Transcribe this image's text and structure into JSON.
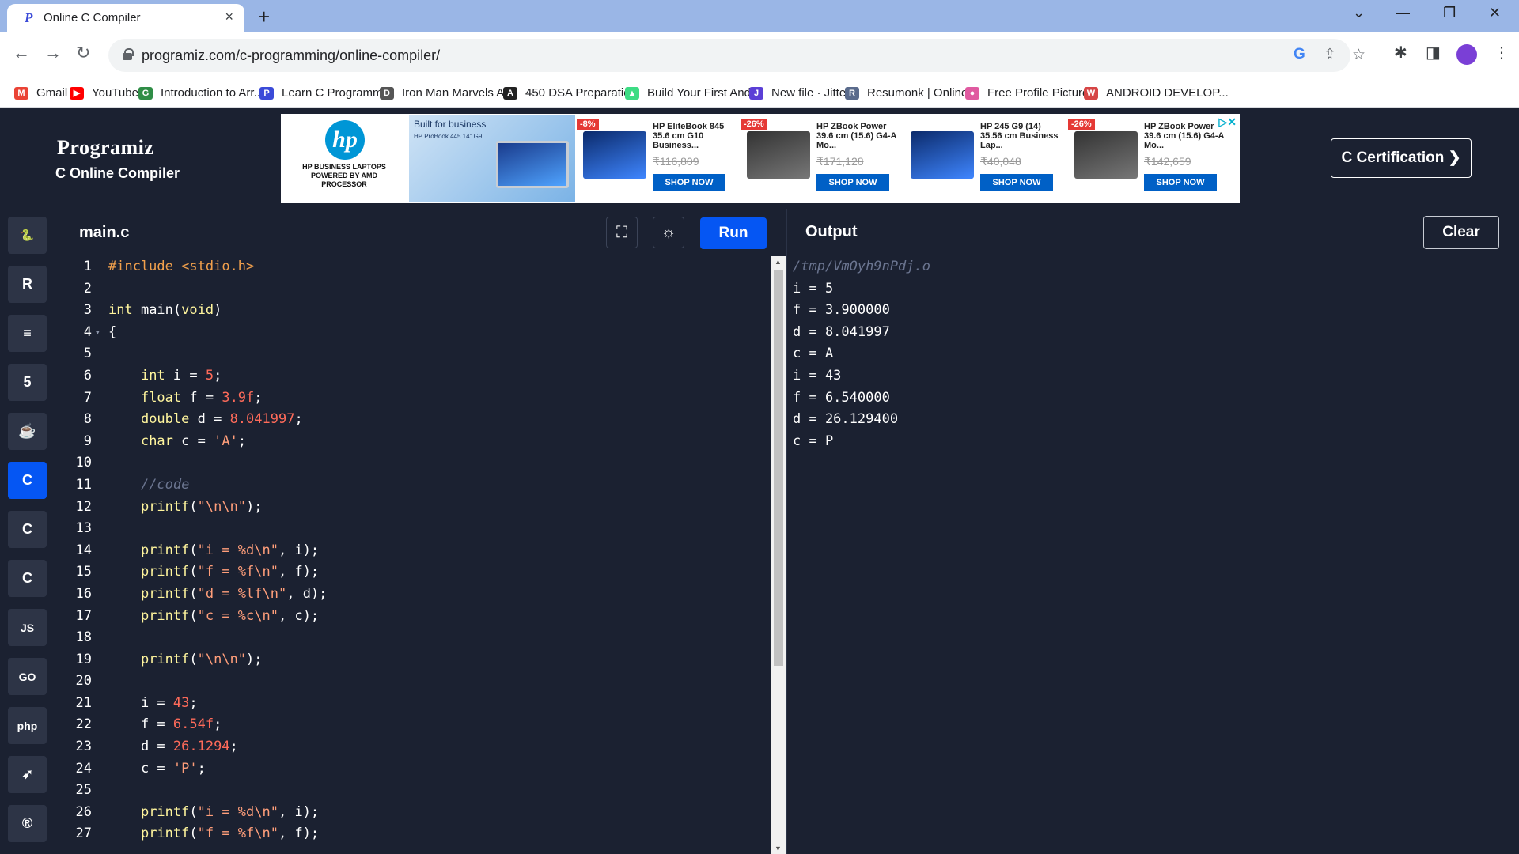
{
  "browser": {
    "tab_title": "Online C Compiler",
    "tab_close": "×",
    "new_tab": "+",
    "url": "programiz.com/c-programming/online-compiler/",
    "bookmarks": [
      {
        "label": "Gmail",
        "icon": "gmail-icon",
        "color": "#ea4335",
        "glyph": "M"
      },
      {
        "label": "YouTube",
        "icon": "youtube-icon",
        "color": "#ff0000",
        "glyph": "▶"
      },
      {
        "label": "Introduction to Arr...",
        "icon": "gfg-icon",
        "color": "#2f8d46",
        "glyph": "G"
      },
      {
        "label": "Learn C Programmi...",
        "icon": "programiz-icon",
        "color": "#3b4bd8",
        "glyph": "P"
      },
      {
        "label": "Iron Man Marvels A...",
        "icon": "hd-icon",
        "color": "#555555",
        "glyph": "D"
      },
      {
        "label": "450 DSA Preparatio...",
        "icon": "angular-icon",
        "color": "#222222",
        "glyph": "A"
      },
      {
        "label": "Build Your First And...",
        "icon": "android-icon",
        "color": "#3ddc84",
        "glyph": "▲"
      },
      {
        "label": "New file · Jitter",
        "icon": "jitter-icon",
        "color": "#5b3fd6",
        "glyph": "J"
      },
      {
        "label": "Resumonk | Online...",
        "icon": "resumonk-icon",
        "color": "#5a6b8c",
        "glyph": "R"
      },
      {
        "label": "Free Profile Picture...",
        "icon": "profile-pic-icon",
        "color": "#e05aa0",
        "glyph": "●"
      },
      {
        "label": "ANDROID DEVELOP...",
        "icon": "android-dev-icon",
        "color": "#d64545",
        "glyph": "W"
      }
    ]
  },
  "site": {
    "logo": "Programiz",
    "subtitle": "C Online Compiler",
    "cert_button": "C Certification ❯"
  },
  "ad": {
    "brand_text": "HP BUSINESS LAPTOPS POWERED BY AMD PROCESSOR",
    "brand_logo": "hp",
    "promo_heading": "Built for business",
    "promo_sub": "HP ProBook 445 14\" G9",
    "items": [
      {
        "discount": "-8%",
        "name": "HP EliteBook 845 35.6 cm G10 Business...",
        "price": "₹116,809",
        "cta": "SHOP NOW"
      },
      {
        "discount": "-26%",
        "name": "HP ZBook Power 39.6 cm (15.6) G4-A Mo...",
        "price": "₹171,128",
        "cta": "SHOP NOW"
      },
      {
        "discount": "",
        "name": "HP 245 G9 (14) 35.56 cm Business Lap...",
        "price": "₹40,048",
        "cta": "SHOP NOW"
      },
      {
        "discount": "-26%",
        "name": "HP ZBook Power 39.6 cm (15.6) G4-A Mo...",
        "price": "₹142,659",
        "cta": "SHOP NOW"
      }
    ]
  },
  "sidebar": {
    "languages": [
      {
        "name": "python",
        "glyph": "🐍",
        "active": false
      },
      {
        "name": "r",
        "glyph": "R",
        "active": false
      },
      {
        "name": "sql",
        "glyph": "≡",
        "active": false
      },
      {
        "name": "html",
        "glyph": "5",
        "active": false
      },
      {
        "name": "java",
        "glyph": "☕",
        "active": false
      },
      {
        "name": "c",
        "glyph": "C",
        "active": true
      },
      {
        "name": "cpp",
        "glyph": "C",
        "active": false
      },
      {
        "name": "csharp",
        "glyph": "C",
        "active": false
      },
      {
        "name": "javascript",
        "glyph": "JS",
        "active": false
      },
      {
        "name": "go",
        "glyph": "GO",
        "active": false
      },
      {
        "name": "php",
        "glyph": "php",
        "active": false
      },
      {
        "name": "swift",
        "glyph": "➶",
        "active": false
      },
      {
        "name": "rust",
        "glyph": "®",
        "active": false
      }
    ]
  },
  "editor": {
    "filename": "main.c",
    "run_label": "Run",
    "lines": [
      {
        "n": "1",
        "fold": "",
        "html": "<span class='t-inc'>#include</span> <span class='t-inc'>&lt;stdio.h&gt;</span>"
      },
      {
        "n": "2",
        "fold": "",
        "html": ""
      },
      {
        "n": "3",
        "fold": "",
        "html": "<span class='t-type'>int</span> main(<span class='t-type'>void</span>)"
      },
      {
        "n": "4",
        "fold": "▾",
        "html": "{"
      },
      {
        "n": "5",
        "fold": "",
        "html": ""
      },
      {
        "n": "6",
        "fold": "",
        "html": "    <span class='t-type'>int</span> i = <span class='t-num'>5</span>;"
      },
      {
        "n": "7",
        "fold": "",
        "html": "    <span class='t-type'>float</span> f = <span class='t-num'>3.9f</span>;"
      },
      {
        "n": "8",
        "fold": "",
        "html": "    <span class='t-type'>double</span> d = <span class='t-num'>8.041997</span>;"
      },
      {
        "n": "9",
        "fold": "",
        "html": "    <span class='t-type'>char</span> c = <span class='t-str'>'A'</span>;"
      },
      {
        "n": "10",
        "fold": "",
        "html": ""
      },
      {
        "n": "11",
        "fold": "",
        "html": "    <span class='t-cmt'>//code</span>"
      },
      {
        "n": "12",
        "fold": "",
        "html": "    <span class='t-fn'>printf</span>(<span class='t-str'>\"\\n\\n\"</span>);"
      },
      {
        "n": "13",
        "fold": "",
        "html": ""
      },
      {
        "n": "14",
        "fold": "",
        "html": "    <span class='t-fn'>printf</span>(<span class='t-str'>\"i = %d\\n\"</span>, i);"
      },
      {
        "n": "15",
        "fold": "",
        "html": "    <span class='t-fn'>printf</span>(<span class='t-str'>\"f = %f\\n\"</span>, f);"
      },
      {
        "n": "16",
        "fold": "",
        "html": "    <span class='t-fn'>printf</span>(<span class='t-str'>\"d = %lf\\n\"</span>, d);"
      },
      {
        "n": "17",
        "fold": "",
        "html": "    <span class='t-fn'>printf</span>(<span class='t-str'>\"c = %c\\n\"</span>, c);"
      },
      {
        "n": "18",
        "fold": "",
        "html": ""
      },
      {
        "n": "19",
        "fold": "",
        "html": "    <span class='t-fn'>printf</span>(<span class='t-str'>\"\\n\\n\"</span>);"
      },
      {
        "n": "20",
        "fold": "",
        "html": ""
      },
      {
        "n": "21",
        "fold": "",
        "html": "    i = <span class='t-num'>43</span>;"
      },
      {
        "n": "22",
        "fold": "",
        "html": "    f = <span class='t-num'>6.54f</span>;"
      },
      {
        "n": "23",
        "fold": "",
        "html": "    d = <span class='t-num'>26.1294</span>;"
      },
      {
        "n": "24",
        "fold": "",
        "html": "    c = <span class='t-str'>'P'</span>;"
      },
      {
        "n": "25",
        "fold": "",
        "html": ""
      },
      {
        "n": "26",
        "fold": "",
        "html": "    <span class='t-fn'>printf</span>(<span class='t-str'>\"i = %d\\n\"</span>, i);"
      },
      {
        "n": "27",
        "fold": "",
        "html": "    <span class='t-fn'>printf</span>(<span class='t-str'>\"f = %f\\n\"</span>, f);"
      }
    ]
  },
  "output": {
    "title": "Output",
    "clear_label": "Clear",
    "path": "/tmp/VmOyh9nPdj.o",
    "lines": [
      "i = 5",
      "f = 3.900000",
      "d = 8.041997",
      "c = A",
      "i = 43",
      "f = 6.540000",
      "d = 26.129400",
      "c = P"
    ]
  },
  "colors": {
    "accent": "#0556f3",
    "background": "#1b2131"
  }
}
